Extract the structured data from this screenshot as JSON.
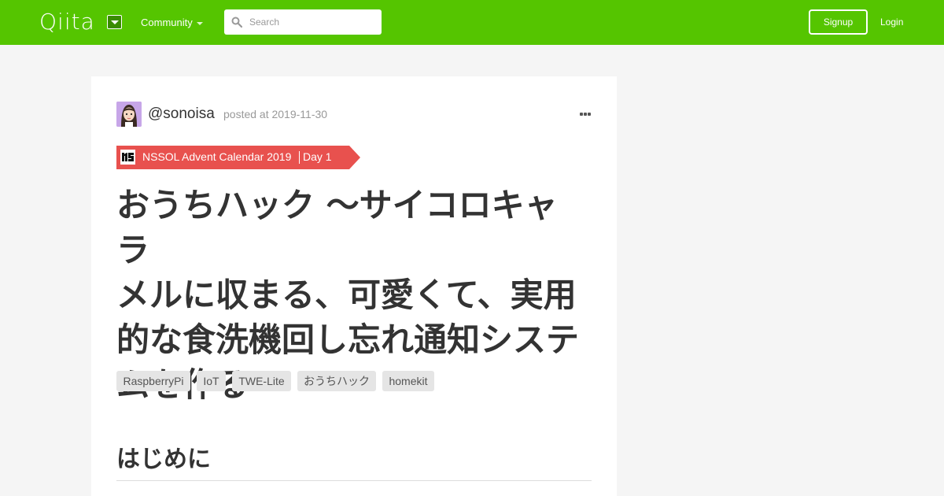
{
  "header": {
    "logo": "Qiita",
    "community_label": "Community",
    "search_placeholder": "Search",
    "signup_label": "Signup",
    "login_label": "Login",
    "brand_color": "#55c500"
  },
  "article": {
    "author": "@sonoisa",
    "posted": "posted at 2019-11-30",
    "calendar": {
      "name": "NSSOL Advent Calendar 2019",
      "day": "Day 1",
      "ribbon_color": "#e8514e"
    },
    "title_lines": [
      "おうちハック 〜サイコロキャラ",
      "メルに収まる、可愛くて、実用",
      "的な食洗機回し忘れ通知システ",
      "ムを作る〜"
    ],
    "tags": [
      "RaspberryPi",
      "IoT",
      "TWE-Lite",
      "おうちハック",
      "homekit"
    ],
    "first_heading": "はじめに"
  },
  "icons": {
    "search": "search-icon",
    "more": "more-options-icon",
    "dropdown": "chevron-down-icon"
  }
}
